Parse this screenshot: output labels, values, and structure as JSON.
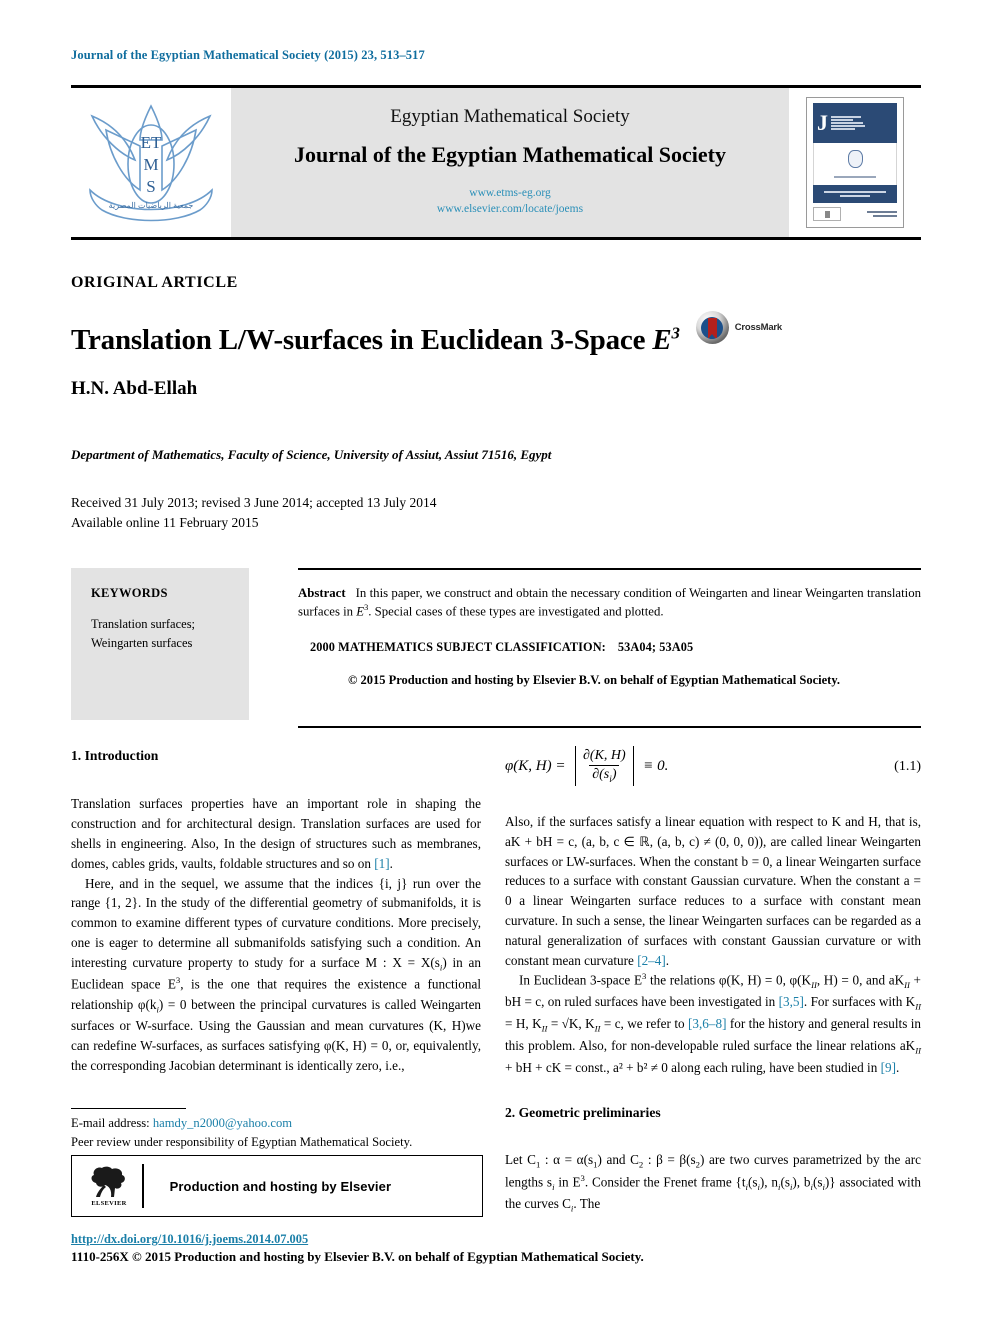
{
  "running_head": "Journal of the Egyptian Mathematical Society (2015) 23, 513–517",
  "masthead": {
    "logo_text": {
      "line1": "E",
      "line2": "T",
      "line3": "M",
      "line4": "S"
    },
    "society": "Egyptian Mathematical Society",
    "journal": "Journal of the Egyptian Mathematical Society",
    "url1": "www.etms-eg.org",
    "url2": "www.elsevier.com/locate/joems",
    "cover_journal_initial": "J"
  },
  "article": {
    "type": "ORIGINAL ARTICLE",
    "title_main": "Translation L/W-surfaces in Euclidean 3-Space ",
    "title_symbol": "E",
    "title_superscript": "3",
    "crossmark_label": "CrossMark",
    "author": "H.N. Abd-Ellah",
    "affiliation": "Department of Mathematics, Faculty of Science, University of Assiut, Assiut 71516, Egypt",
    "received": "Received 31 July 2013; revised 3 June 2014; accepted 13 July 2014",
    "available": "Available online 11 February 2015"
  },
  "keywords": {
    "heading": "KEYWORDS",
    "items": [
      "Translation surfaces;",
      "Weingarten surfaces"
    ]
  },
  "abstract": {
    "label": "Abstract",
    "text_part1": "In this paper, we construct and obtain the necessary condition of Weingarten and linear Weingarten translation surfaces in ",
    "symbol": "E",
    "symbol_sup": "3",
    "text_part2": ". Special cases of these types are investigated and plotted.",
    "msc_label": "2000 MATHEMATICS SUBJECT CLASSIFICATION:",
    "msc_codes": "53A04; 53A05",
    "copyright": "© 2015 Production and hosting by Elsevier B.V. on behalf of Egyptian Mathematical Society."
  },
  "sections": {
    "intro_heading": "1. Introduction",
    "geo_heading": "2. Geometric preliminaries"
  },
  "left_column": {
    "para1_a": "Translation surfaces properties have an important role in shaping the construction and for architectural design. Translation surfaces are used for shells in engineering. Also, In the design of structures such as membranes, domes, cables grids, vaults, foldable structures and so on ",
    "para1_ref": "[1]",
    "para1_b": ".",
    "para2": "Here, and in the sequel, we assume that the indices {i, j} run over the range {1, 2}. In the study of the differential geometry of submanifolds, it is common to examine different types of curvature conditions. More precisely, one is eager to determine all submanifolds satisfying such a condition. An interesting curvature property to study for a surface M : X = X(s",
    "para2_b": ") in an Euclidean space E",
    "para2_c": ", is the one that requires the existence a functional relationship φ(k",
    "para2_d": ") = 0 between the principal curvatures is called Weingarten surfaces or W-surface. Using the Gaussian and mean curvatures (K, H)we can redefine W-surfaces, as surfaces satisfying  φ(K, H) = 0, or, equivalently, the corresponding Jacobian determinant is identically zero, i.e.,"
  },
  "right_column": {
    "equation": {
      "lhs": "φ(K, H) =",
      "numerator": "∂(K, H)",
      "denominator": "∂(s",
      "denominator_sub": "i",
      "denominator_end": ")",
      "rhs": "≡ 0.",
      "number": "(1.1)"
    },
    "para1_a": "Also, if the surfaces satisfy a linear equation with respect to K and H, that is, aK + bH = c, (a, b, c ∈ ℝ, (a, b, c) ≠ (0, 0, 0)), are called linear Weingarten surfaces or LW-surfaces. When the constant b = 0, a linear Weingarten surface reduces to a surface with constant Gaussian curvature. When the constant a = 0 a linear Weingarten surface reduces to a surface with constant mean curvature. In such a sense, the linear Weingarten surfaces can be regarded as a natural generalization of surfaces with constant Gaussian curvature or with constant mean curvature ",
    "para1_ref": "[2–4]",
    "para1_b": ".",
    "para2_a": "In Euclidean 3-space E",
    "para2_b": " the relations  φ(K, H) = 0, φ(K",
    "para2_c": ", H) = 0, and aK",
    "para2_d": " + bH = c, on ruled surfaces have been investigated in ",
    "para2_ref1": "[3,5]",
    "para2_e": ". For surfaces with K",
    "para2_f": " = H, K",
    "para2_g": " = √K, K",
    "para2_h": " = c, we refer to ",
    "para2_ref2": "[3,6–8]",
    "para2_i": " for the history and general results in this problem. Also, for non-developable ruled surface the linear relations  aK",
    "para2_j": " + bH + cK = const.,  a² + b² ≠ 0  along each ruling, have been studied in ",
    "para2_ref3": "[9]",
    "para2_k": ".",
    "para3_a": "Let C",
    "para3_b": " : α = α(s",
    "para3_c": ") and C",
    "para3_d": " : β = β(s",
    "para3_e": ") are two curves parametrized by the arc lengths s",
    "para3_f": " in E",
    "para3_g": ". Consider the Frenet frame {t",
    "para3_h": "(s",
    "para3_i": "), n",
    "para3_j": "(s",
    "para3_k": "), b",
    "para3_l": "(s",
    "para3_m": ")}  associated  with  the  curves  C",
    "para3_n": ". The"
  },
  "footnote": {
    "email_label": "E-mail address:",
    "email": "hamdy_n2000@yahoo.com",
    "peer_review": "Peer review under responsibility of Egyptian Mathematical Society."
  },
  "elsevier_box": {
    "wordmark": "ELSEVIER",
    "text": "Production and hosting by Elsevier"
  },
  "page_footer": {
    "doi": "http://dx.doi.org/10.1016/j.joems.2014.07.005",
    "line": "1110-256X © 2015 Production and hosting by Elsevier B.V. on behalf of Egyptian Mathematical Society."
  },
  "colors": {
    "link_blue": "#1a7fa8",
    "masthead_url_blue": "#2a8fb8",
    "keyword_bg": "#e3e3e3",
    "cover_navy": "#2b4a75",
    "crossmark_red": "#b3201d"
  }
}
